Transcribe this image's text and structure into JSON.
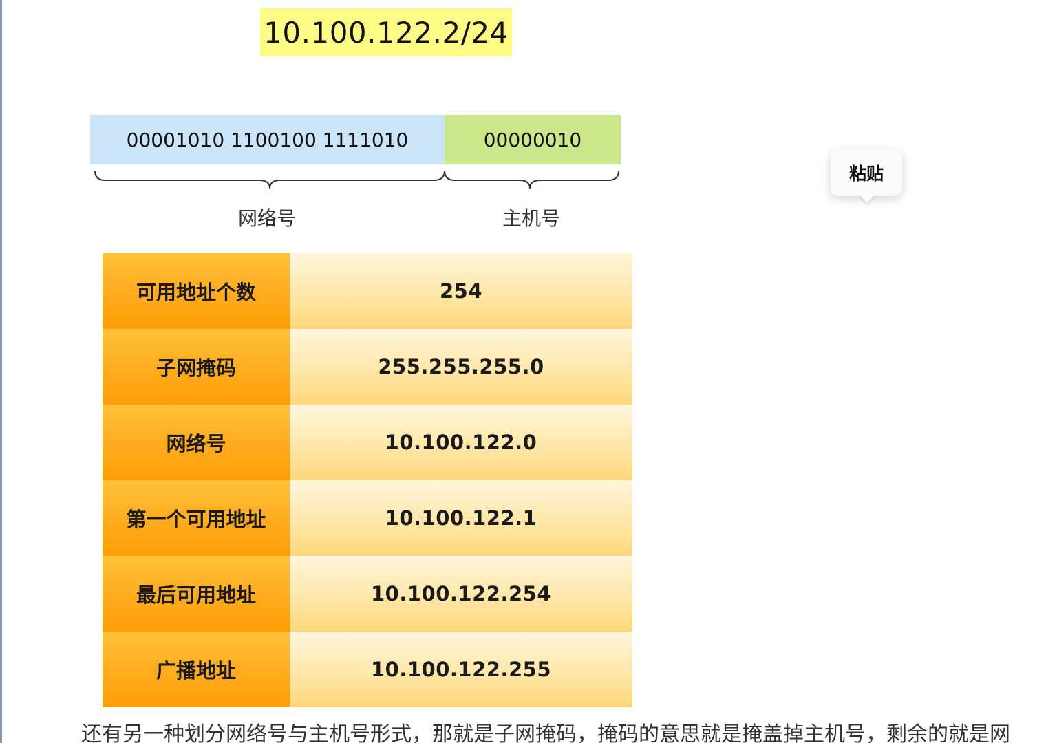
{
  "diagram": {
    "ip_cidr": "10.100.122.2/24",
    "network_bits": "00001010 1100100 1111010",
    "host_bits": "00000010",
    "network_label": "网络号",
    "host_label": "主机号"
  },
  "table": {
    "rows": [
      {
        "key": "可用地址个数",
        "value": "254"
      },
      {
        "key": "子网掩码",
        "value": "255.255.255.0"
      },
      {
        "key": "网络号",
        "value": "10.100.122.0"
      },
      {
        "key": "第一个可用地址",
        "value": "10.100.122.1"
      },
      {
        "key": "最后可用地址",
        "value": "10.100.122.254"
      },
      {
        "key": "广播地址",
        "value": "10.100.122.255"
      }
    ]
  },
  "context_menu": {
    "paste_label": "粘贴"
  },
  "article": {
    "paragraph": "还有另一种划分网络号与主机号形式，那就是子网掩码，掩码的意思就是掩盖掉主机号，剩余的就是网"
  },
  "colors": {
    "ip_highlight": "#fbfb86",
    "network_bits_bg": "#cce4f8",
    "host_bits_bg": "#cde88c",
    "table_key_bg": "#ffab1e",
    "table_value_bg": "#ffe7a9"
  }
}
